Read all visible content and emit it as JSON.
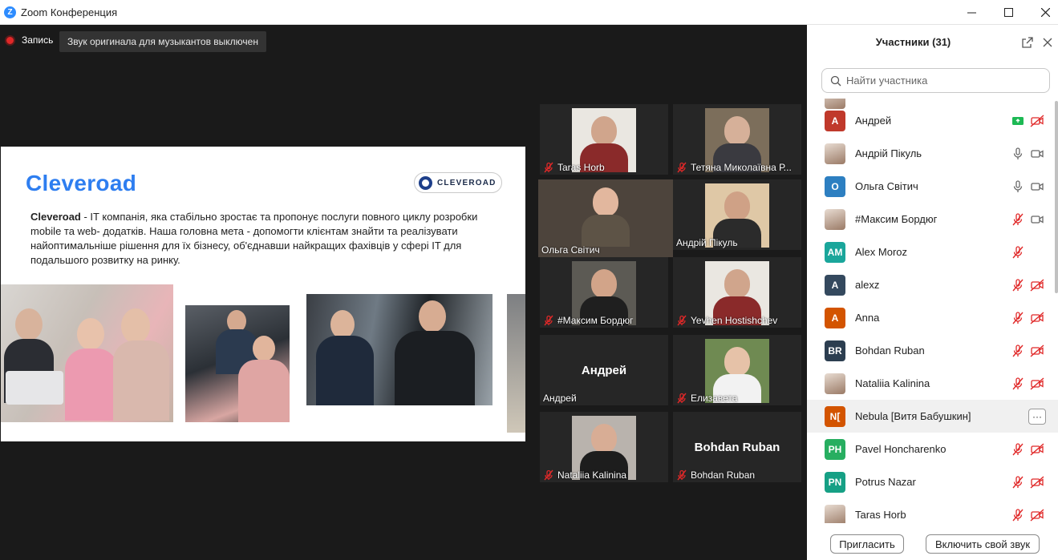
{
  "window": {
    "title": "Zoom Конференция",
    "icon": "Z"
  },
  "meeting": {
    "recording_label": "Запись",
    "audio_notice": "Звук оригинала для музыкантов выключен"
  },
  "slide": {
    "title": "Cleveroad",
    "logo_text": "CLEVEROAD",
    "bold_lead": "Cleveroad",
    "body": " - IT компанія, яка стабільно зростає та пропонує послуги повного циклу розробки mobile та web- додатків. Наша головна мета - допомогти клієнтам знайти та реалізувати найоптимальніше рішення для їх бізнесу, об'єднавши найкращих фахівців у сфері IT для подальшого розвитку на ринку."
  },
  "tiles": [
    {
      "name": "Taras Horb",
      "muted": true,
      "video": true
    },
    {
      "name": "Тетяна Миколаївна Р...",
      "muted": true,
      "video": true
    },
    {
      "name": "Ольга Світич",
      "muted": false,
      "video": true,
      "active": true
    },
    {
      "name": "Андрій Пікуль",
      "muted": false,
      "video": true
    },
    {
      "name": "#Максим Бордюг",
      "muted": true,
      "video": true
    },
    {
      "name": "Yevhen Hostishchev",
      "muted": true,
      "video": true
    },
    {
      "name": "Андрей",
      "muted": false,
      "video": false,
      "big": "Андрей"
    },
    {
      "name": "Елизавета",
      "muted": true,
      "video": true
    },
    {
      "name": "Nataliia Kalinina",
      "muted": true,
      "video": true
    },
    {
      "name": "Bohdan Ruban",
      "muted": true,
      "video": false,
      "big": "Bohdan Ruban"
    }
  ],
  "panel": {
    "title": "Участники (31)",
    "search_placeholder": "Найти участника",
    "invite_label": "Пригласить",
    "unmute_label": "Включить свой звук",
    "participants": [
      {
        "initials": "A",
        "name": "Андрей",
        "color": "#c0392b",
        "mic": "share",
        "cam": "off"
      },
      {
        "initials": "",
        "name": "Андрій Пікуль",
        "color": "",
        "mic": "on",
        "cam": "on"
      },
      {
        "initials": "O",
        "name": "Ольга Світич",
        "color": "#2d7fc1",
        "mic": "on",
        "cam": "on"
      },
      {
        "initials": "",
        "name": "#Максим Бордюг",
        "color": "",
        "mic": "off",
        "cam": "on"
      },
      {
        "initials": "AM",
        "name": "Alex Moroz",
        "color": "#1aa69b",
        "mic": "off",
        "cam": "none"
      },
      {
        "initials": "A",
        "name": "alexz",
        "color": "#34495e",
        "mic": "off",
        "cam": "off"
      },
      {
        "initials": "A",
        "name": "Anna",
        "color": "#d35400",
        "mic": "off",
        "cam": "off"
      },
      {
        "initials": "BR",
        "name": "Bohdan Ruban",
        "color": "#2c3e50",
        "mic": "off",
        "cam": "off"
      },
      {
        "initials": "",
        "name": "Nataliia Kalinina",
        "color": "",
        "mic": "off",
        "cam": "off"
      },
      {
        "initials": "N[",
        "name": "Nebula [Витя Бабушкин]",
        "color": "#d35400",
        "mic": "more",
        "cam": "none",
        "highlight": true
      },
      {
        "initials": "PH",
        "name": "Pavel Honcharenko",
        "color": "#27ae60",
        "mic": "off",
        "cam": "off"
      },
      {
        "initials": "PN",
        "name": "Potrus Nazar",
        "color": "#16a085",
        "mic": "off",
        "cam": "off"
      },
      {
        "initials": "",
        "name": "Taras Horb",
        "color": "",
        "mic": "off",
        "cam": "off"
      }
    ]
  }
}
